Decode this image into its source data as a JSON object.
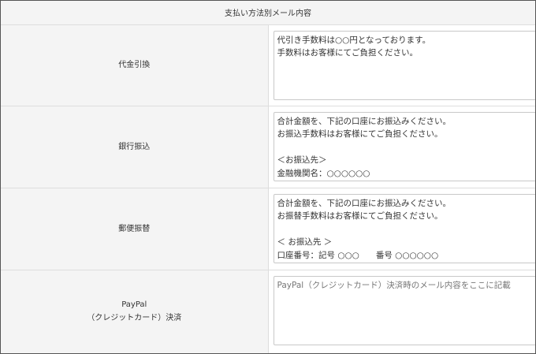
{
  "header": {
    "title": "支払い方法別メール内容"
  },
  "rows": [
    {
      "label": "代金引換",
      "value": "代引き手数料は○○円となっております。\n手数料はお客様にてご負担ください。",
      "placeholder": ""
    },
    {
      "label": "銀行振込",
      "value": "合計金額を、下記の口座にお振込みください。\nお振込手数料はお客様にてご負担ください。\n\n＜お振込先＞\n金融機関名：○○○○○○\n支店名：",
      "placeholder": ""
    },
    {
      "label": "郵便振替",
      "value": "合計金額を、下記の口座にお振込みください。\nお振替手数料はお客様にてご負担ください。\n\n＜ お振込先 ＞\n口座番号：記号 ○○○　　番号 ○○○○○○\n口座名義：",
      "placeholder": ""
    },
    {
      "label_line1": "PayPal",
      "label_line2": "（クレジットカード）決済",
      "value": "",
      "placeholder": "PayPal（クレジットカード）決済時のメール内容をここに記載"
    }
  ]
}
